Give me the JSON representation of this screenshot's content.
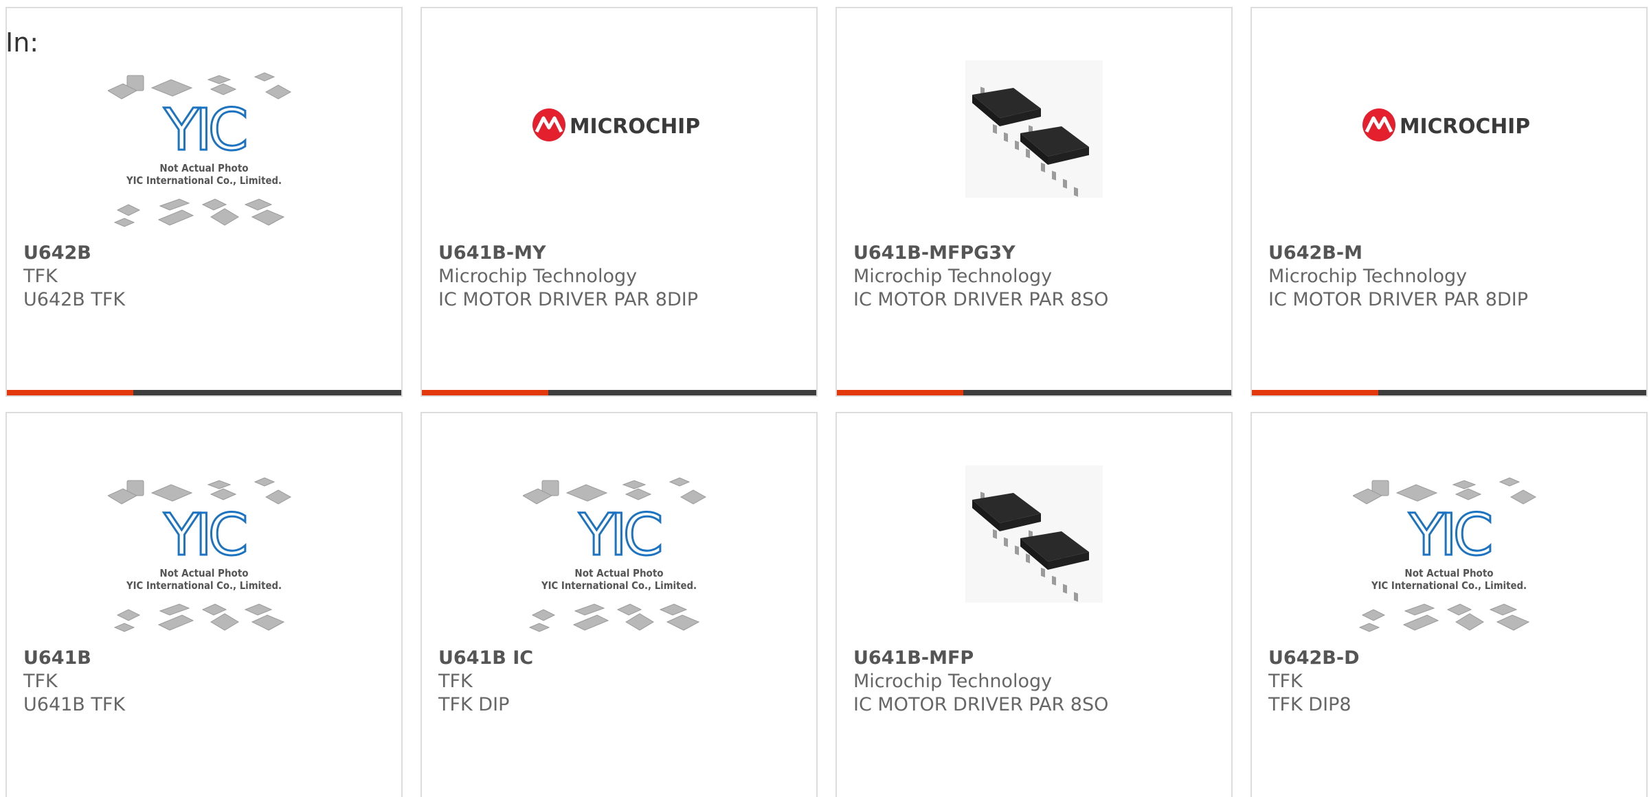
{
  "header": {
    "label": "In:"
  },
  "colors": {
    "accent": "#e2380b",
    "bar": "#3d3d3d",
    "microchip_red": "#e4202e",
    "yic_blue": "#1c73c1"
  },
  "products": [
    {
      "part": "U642B",
      "manufacturer": "TFK",
      "description": "U642B TFK",
      "image": "yic-placeholder",
      "placeholder_line1": "Not Actual Photo",
      "placeholder_line2": "YIC International Co., Limited.",
      "progress": 0.32
    },
    {
      "part": "U641B-MY",
      "manufacturer": "Microchip Technology",
      "description": "IC MOTOR DRIVER PAR 8DIP",
      "image": "microchip-logo",
      "logo_text": "MICROCHIP",
      "progress": 0.32
    },
    {
      "part": "U641B-MFPG3Y",
      "manufacturer": "Microchip Technology",
      "description": "IC MOTOR DRIVER PAR 8SO",
      "image": "soic-chip-photo",
      "progress": 0.32
    },
    {
      "part": "U642B-M",
      "manufacturer": "Microchip Technology",
      "description": "IC MOTOR DRIVER PAR 8DIP",
      "image": "microchip-logo",
      "logo_text": "MICROCHIP",
      "progress": 0.32
    },
    {
      "part": "U641B",
      "manufacturer": "TFK",
      "description": "U641B TFK",
      "image": "yic-placeholder",
      "placeholder_line1": "Not Actual Photo",
      "placeholder_line2": "YIC International Co., Limited."
    },
    {
      "part": "U641B IC",
      "manufacturer": "TFK",
      "description": "TFK DIP",
      "image": "yic-placeholder",
      "placeholder_line1": "Not Actual Photo",
      "placeholder_line2": "YIC International Co., Limited."
    },
    {
      "part": "U641B-MFP",
      "manufacturer": "Microchip Technology",
      "description": "IC MOTOR DRIVER PAR 8SO",
      "image": "soic-chip-photo"
    },
    {
      "part": "U642B-D",
      "manufacturer": "TFK",
      "description": "TFK DIP8",
      "image": "yic-placeholder",
      "placeholder_line1": "Not Actual Photo",
      "placeholder_line2": "YIC International Co., Limited."
    }
  ]
}
